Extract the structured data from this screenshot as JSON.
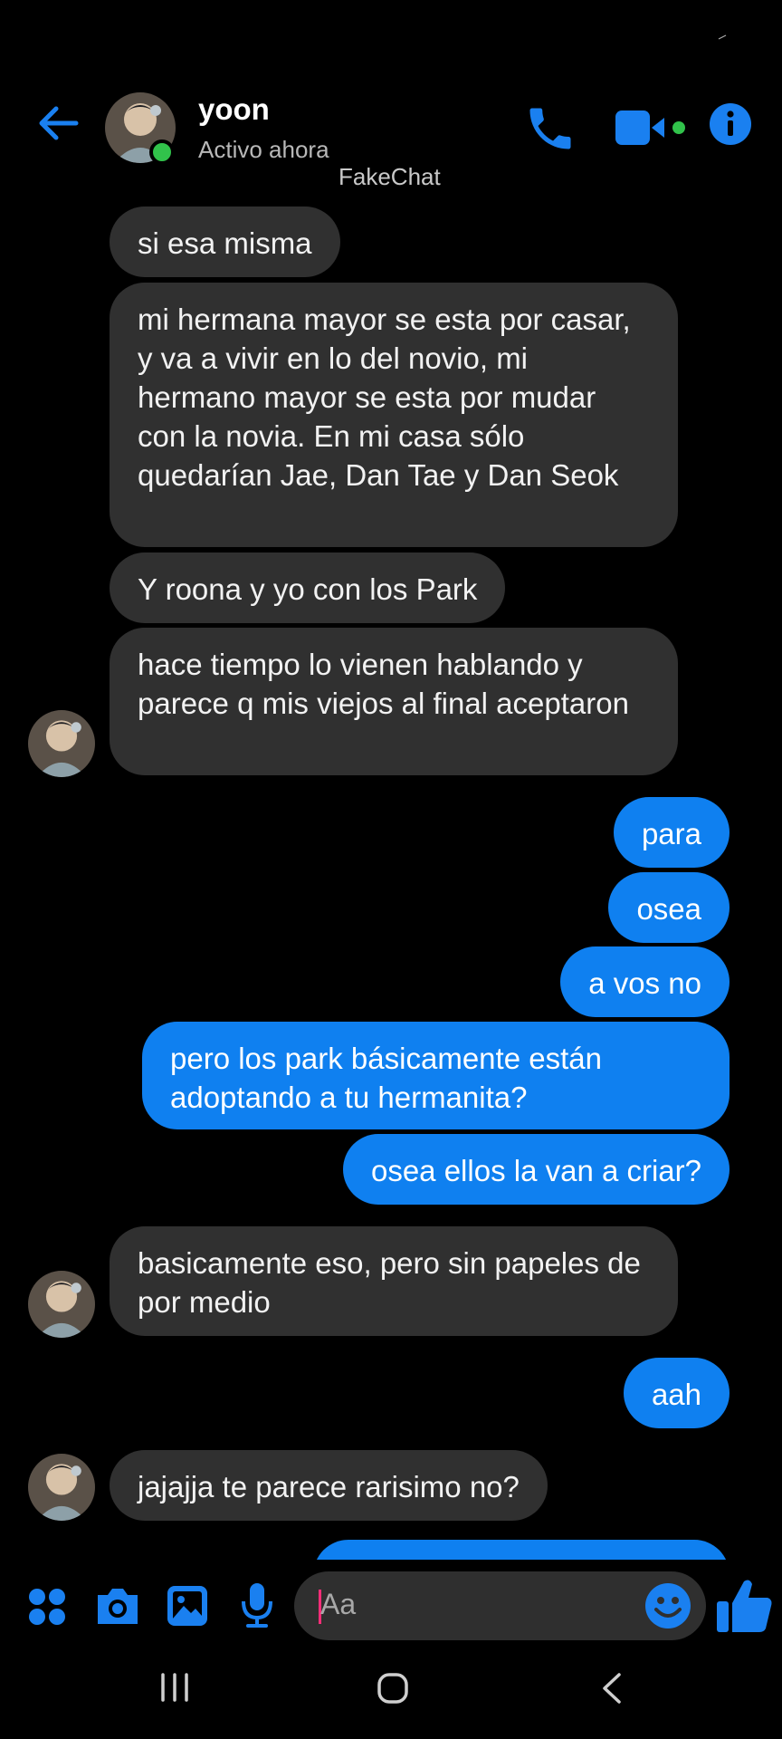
{
  "header": {
    "contact_name": "yoon",
    "status_text": "Activo ahora",
    "watermark": "FakeChat"
  },
  "messages": [
    {
      "from": "them",
      "text": "si esa misma"
    },
    {
      "from": "them",
      "text": "mi hermana mayor se esta por casar, y va a vivir en lo del novio, mi hermano mayor se esta por mudar con la novia. En mi casa sólo quedarían Jae, Dan Tae y Dan Seok"
    },
    {
      "from": "them",
      "text": "Y roona y yo con los Park"
    },
    {
      "from": "them",
      "text": "hace tiempo lo vienen hablando y parece q mis viejos al final aceptaron"
    },
    {
      "from": "me",
      "text": "para"
    },
    {
      "from": "me",
      "text": "osea"
    },
    {
      "from": "me",
      "text": "a vos no"
    },
    {
      "from": "me",
      "text": "pero los park básicamente están adoptando a tu hermanita?"
    },
    {
      "from": "me",
      "text": "osea ellos la van a criar?"
    },
    {
      "from": "them",
      "text": "basicamente eso, pero sin papeles de por medio"
    },
    {
      "from": "me",
      "text": "aah"
    },
    {
      "from": "them",
      "text": "jajajja te parece rarisimo no?"
    }
  ],
  "composer": {
    "placeholder": "Aa"
  },
  "colors": {
    "accent": "#0f80f0",
    "incoming_bubble": "#303030",
    "online": "#31c24b",
    "cursor": "#ff2d78"
  },
  "icons": [
    "back-arrow-icon",
    "phone-icon",
    "video-camera-icon",
    "info-icon",
    "apps-grid-icon",
    "camera-icon",
    "gallery-icon",
    "microphone-icon",
    "emoji-icon",
    "thumbs-up-icon"
  ]
}
